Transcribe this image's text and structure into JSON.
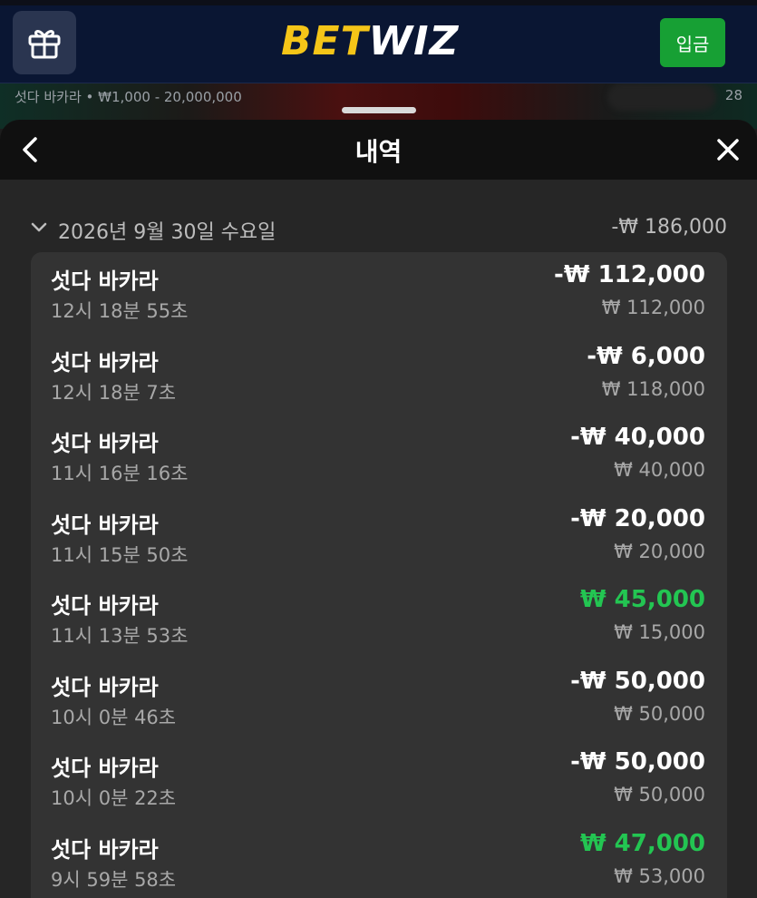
{
  "header": {
    "logo_left": "BET",
    "logo_right": "WIZ",
    "deposit_label": "입금",
    "brand_yellow": "#f5c518",
    "deposit_green": "#17a034"
  },
  "background": {
    "game_caption": "섯다 바카라 • ₩1,000 - 20,000,000",
    "right_caption": "28"
  },
  "sheet": {
    "title": "내역"
  },
  "history": {
    "date_label": "2026년 9월 30일 수요일",
    "date_total": "-₩ 186,000",
    "items": [
      {
        "game": "섯다 바카라",
        "time": "12시 18분 55초",
        "amount": "-₩ 112,000",
        "bet": "₩ 112,000",
        "win": false
      },
      {
        "game": "섯다 바카라",
        "time": "12시 18분 7초",
        "amount": "-₩ 6,000",
        "bet": "₩ 118,000",
        "win": false
      },
      {
        "game": "섯다 바카라",
        "time": "11시 16분 16초",
        "amount": "-₩ 40,000",
        "bet": "₩ 40,000",
        "win": false
      },
      {
        "game": "섯다 바카라",
        "time": "11시 15분 50초",
        "amount": "-₩ 20,000",
        "bet": "₩ 20,000",
        "win": false
      },
      {
        "game": "섯다 바카라",
        "time": "11시 13분 53초",
        "amount": "₩ 45,000",
        "bet": "₩ 15,000",
        "win": true
      },
      {
        "game": "섯다 바카라",
        "time": "10시 0분 46초",
        "amount": "-₩ 50,000",
        "bet": "₩ 50,000",
        "win": false
      },
      {
        "game": "섯다 바카라",
        "time": "10시 0분 22초",
        "amount": "-₩ 50,000",
        "bet": "₩ 50,000",
        "win": false
      },
      {
        "game": "섯다 바카라",
        "time": "9시 59분 58초",
        "amount": "₩ 47,000",
        "bet": "₩ 53,000",
        "win": true
      }
    ],
    "win_color": "#23c552"
  }
}
